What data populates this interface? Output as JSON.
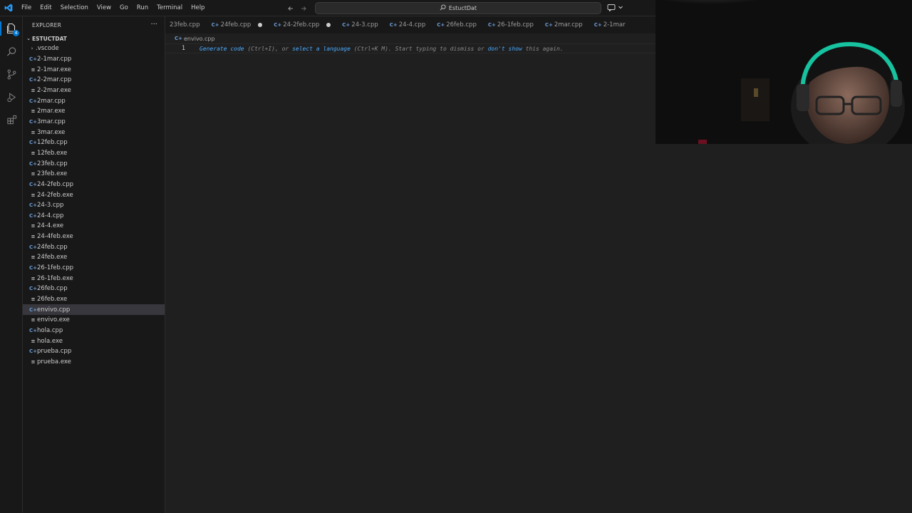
{
  "menu": [
    "File",
    "Edit",
    "Selection",
    "View",
    "Go",
    "Run",
    "Terminal",
    "Help"
  ],
  "search": {
    "text": "EstuctDat"
  },
  "activity": {
    "explorer_badge": "4"
  },
  "sidebar": {
    "title": "EXPLORER",
    "more": "···",
    "folder": "ESTUCTDAT",
    "items": [
      {
        "name": ".vscode",
        "kind": "folder"
      },
      {
        "name": "2-1mar.cpp",
        "kind": "cpp"
      },
      {
        "name": "2-1mar.exe",
        "kind": "exe"
      },
      {
        "name": "2-2mar.cpp",
        "kind": "cpp"
      },
      {
        "name": "2-2mar.exe",
        "kind": "exe"
      },
      {
        "name": "2mar.cpp",
        "kind": "cpp"
      },
      {
        "name": "2mar.exe",
        "kind": "exe"
      },
      {
        "name": "3mar.cpp",
        "kind": "cpp"
      },
      {
        "name": "3mar.exe",
        "kind": "exe"
      },
      {
        "name": "12feb.cpp",
        "kind": "cpp"
      },
      {
        "name": "12feb.exe",
        "kind": "exe"
      },
      {
        "name": "23feb.cpp",
        "kind": "cpp"
      },
      {
        "name": "23feb.exe",
        "kind": "exe"
      },
      {
        "name": "24-2feb.cpp",
        "kind": "cpp"
      },
      {
        "name": "24-2feb.exe",
        "kind": "exe"
      },
      {
        "name": "24-3.cpp",
        "kind": "cpp"
      },
      {
        "name": "24-4.cpp",
        "kind": "cpp"
      },
      {
        "name": "24-4.exe",
        "kind": "exe"
      },
      {
        "name": "24-4feb.exe",
        "kind": "exe"
      },
      {
        "name": "24feb.cpp",
        "kind": "cpp"
      },
      {
        "name": "24feb.exe",
        "kind": "exe"
      },
      {
        "name": "26-1feb.cpp",
        "kind": "cpp"
      },
      {
        "name": "26-1feb.exe",
        "kind": "exe"
      },
      {
        "name": "26feb.cpp",
        "kind": "cpp"
      },
      {
        "name": "26feb.exe",
        "kind": "exe"
      },
      {
        "name": "envivo.cpp",
        "kind": "cpp",
        "selected": true
      },
      {
        "name": "envivo.exe",
        "kind": "exe"
      },
      {
        "name": "hola.cpp",
        "kind": "cpp"
      },
      {
        "name": "hola.exe",
        "kind": "exe"
      },
      {
        "name": "prueba.cpp",
        "kind": "cpp"
      },
      {
        "name": "prueba.exe",
        "kind": "exe"
      }
    ]
  },
  "tabs": [
    {
      "label": "23feb.cpp",
      "icon": false,
      "dirty": false
    },
    {
      "label": "24feb.cpp",
      "icon": true,
      "dirty": true
    },
    {
      "label": "24-2feb.cpp",
      "icon": true,
      "dirty": true
    },
    {
      "label": "24-3.cpp",
      "icon": true,
      "dirty": false
    },
    {
      "label": "24-4.cpp",
      "icon": true,
      "dirty": false
    },
    {
      "label": "26feb.cpp",
      "icon": true,
      "dirty": false
    },
    {
      "label": "26-1feb.cpp",
      "icon": true,
      "dirty": false
    },
    {
      "label": "2mar.cpp",
      "icon": true,
      "dirty": false
    },
    {
      "label": "2-1mar",
      "icon": true,
      "dirty": false
    }
  ],
  "editor": {
    "breadcrumb": "envivo.cpp",
    "line_number": "1",
    "hint": [
      {
        "text": "Generate code",
        "link": true
      },
      {
        "text": " (Ctrl+I), or ",
        "link": false
      },
      {
        "text": "select a language",
        "link": true
      },
      {
        "text": " (Ctrl+K M). Start typing to dismiss or ",
        "link": false
      },
      {
        "text": "don't show",
        "link": true
      },
      {
        "text": " this again.",
        "link": false
      }
    ]
  },
  "colors": {
    "accent": "#0078d4",
    "link": "#4daafc",
    "cpp_icon": "#6c9bd2",
    "selected_row": "#37373d"
  }
}
